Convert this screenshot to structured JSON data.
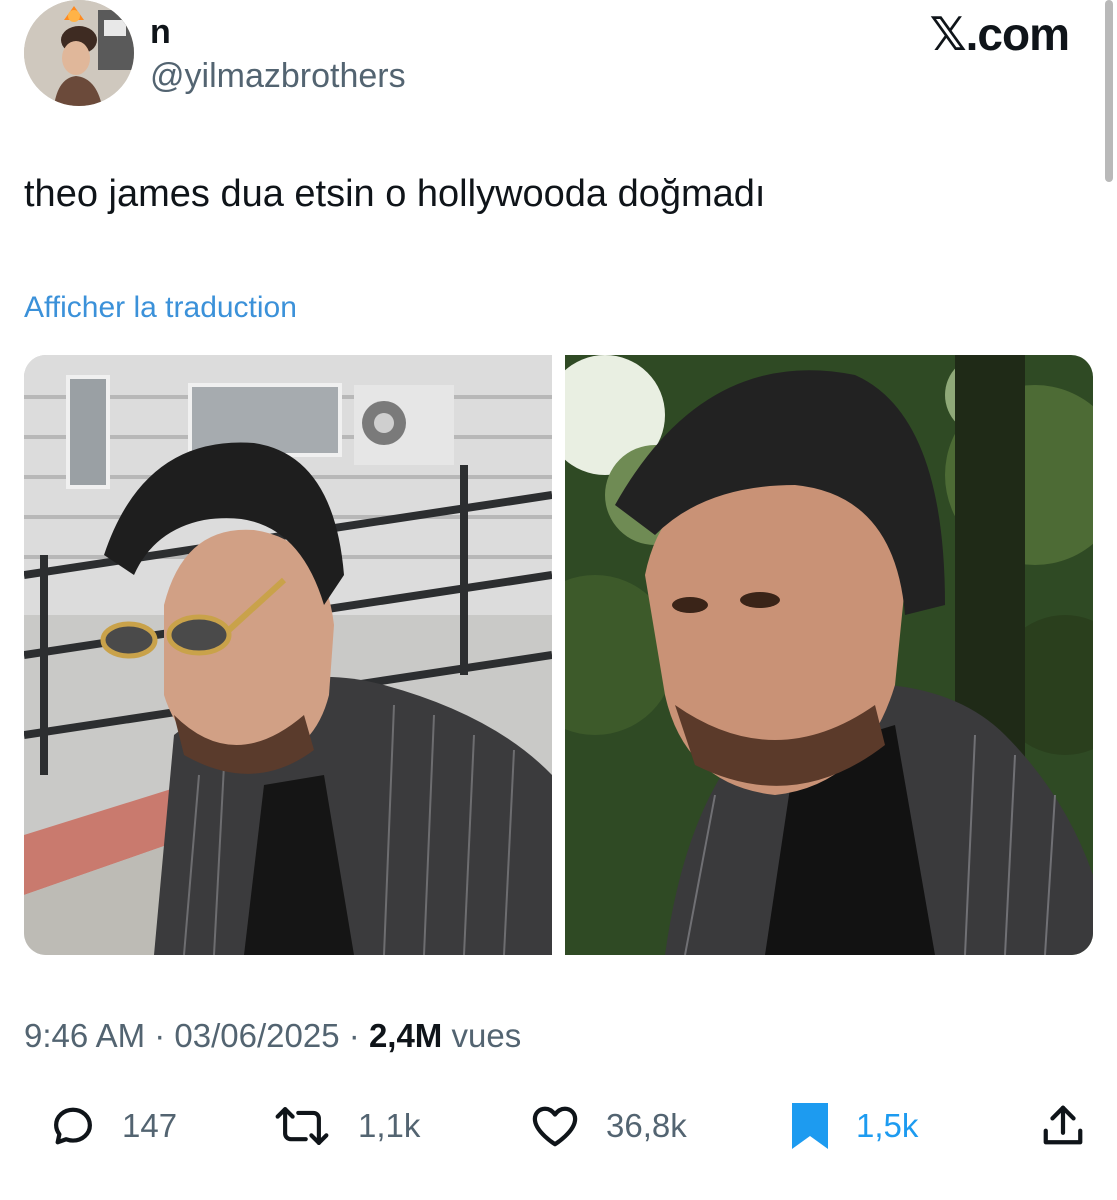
{
  "header": {
    "display_name": "n",
    "handle": "@yilmazbrothers",
    "brand": "𝕏.com"
  },
  "tweet": {
    "text": "theo james dua etsin o hollywooda doğmadı",
    "translate_label": "Afficher la traduction"
  },
  "meta": {
    "time": "9:46 AM",
    "separator": "·",
    "date": "03/06/2025",
    "views_count": "2,4M",
    "views_label": "vues"
  },
  "actions": {
    "replies": "147",
    "reposts": "1,1k",
    "likes": "36,8k",
    "bookmarks": "1,5k"
  },
  "colors": {
    "accent": "#1d9bf0",
    "link": "#3b91d9",
    "secondary_text": "#536471"
  },
  "icons": {
    "reply": "reply-icon",
    "repost": "repost-icon",
    "like": "heart-icon",
    "bookmark": "bookmark-icon",
    "share": "share-icon"
  }
}
